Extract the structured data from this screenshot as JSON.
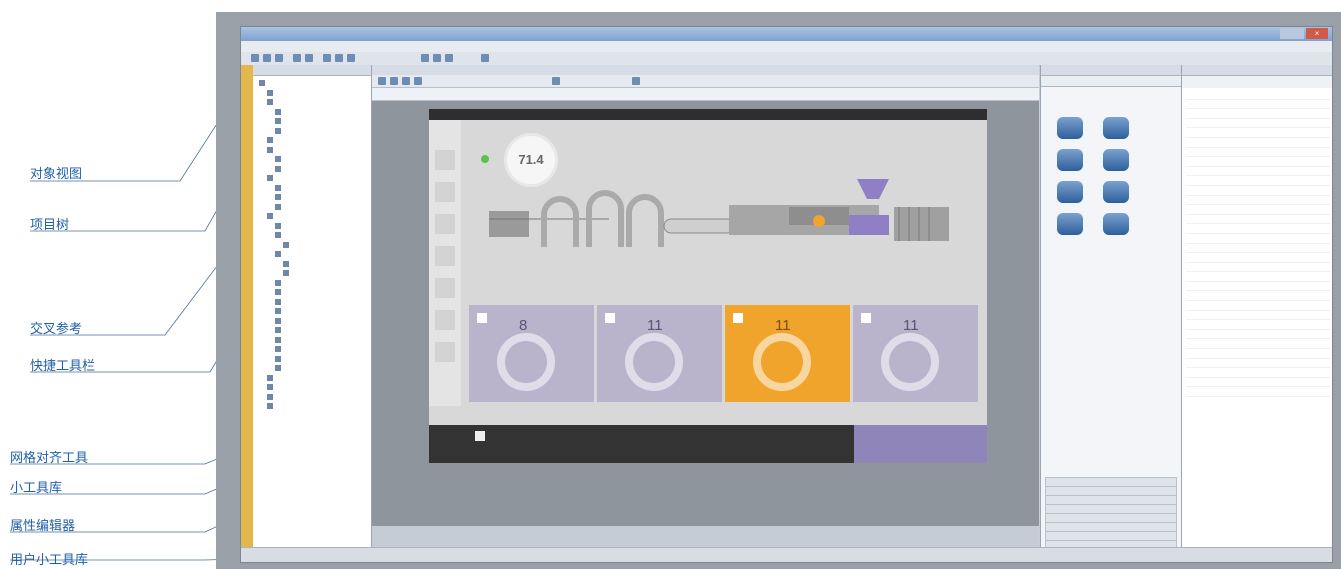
{
  "annotations": [
    {
      "label": "对象视图"
    },
    {
      "label": "项目树"
    },
    {
      "label": "交叉参考"
    },
    {
      "label": "快捷工具栏"
    },
    {
      "label": "网格对齐工具"
    },
    {
      "label": "小工具库"
    },
    {
      "label": "属性编辑器"
    },
    {
      "label": "用户小工具库"
    }
  ],
  "hmi": {
    "gauge_value": "71.4",
    "cards": [
      {
        "value": "8"
      },
      {
        "value": "11"
      },
      {
        "value": "11"
      },
      {
        "value": "11"
      }
    ]
  },
  "colors": {
    "annotation": "#1f5fa8",
    "accent_orange": "#f0a42c",
    "card_purple": "#b9b3cc",
    "status_green": "#5ac24d"
  }
}
